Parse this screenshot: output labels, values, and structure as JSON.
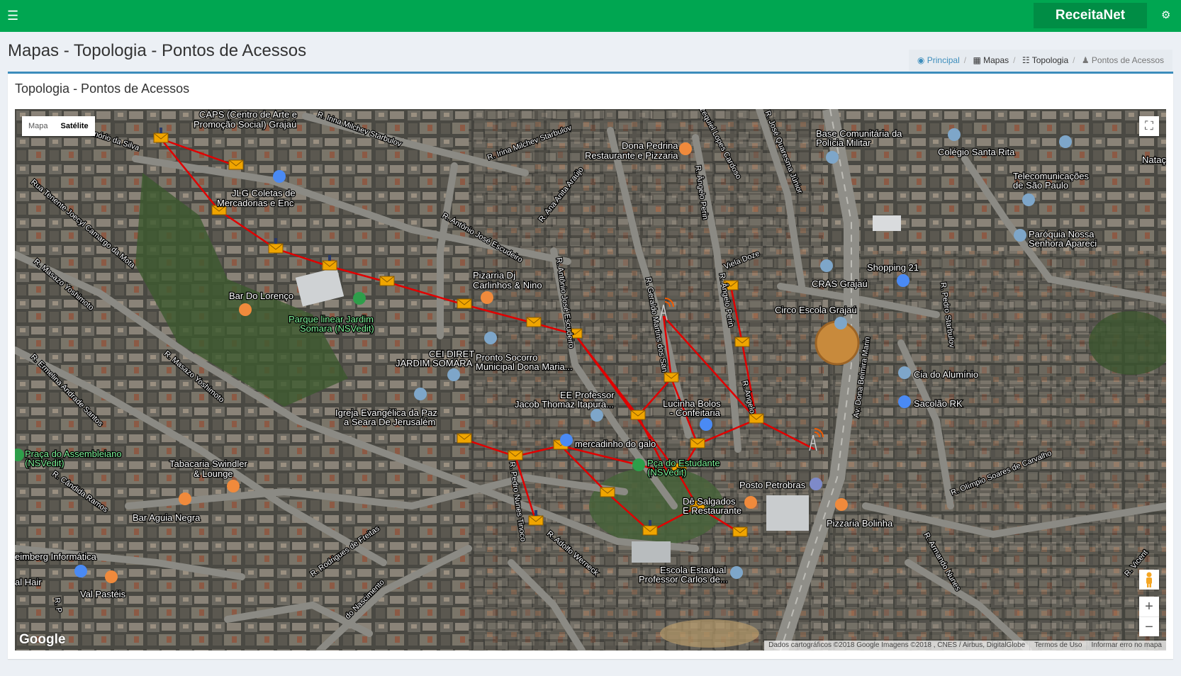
{
  "header": {
    "brand": "ReceitaNet",
    "menu_icon": "hamburger-icon",
    "settings_icon": "gears-icon",
    "brand_color": "#00a651"
  },
  "page": {
    "title": "Mapas - Topologia - Pontos de Acessos"
  },
  "breadcrumb": [
    {
      "label": "Principal",
      "icon": "dashboard-icon"
    },
    {
      "label": "Mapas",
      "icon": "map-icon"
    },
    {
      "label": "Topologia",
      "icon": "sitemap-icon"
    },
    {
      "label": "Pontos de Acessos",
      "icon": "user-icon"
    }
  ],
  "box": {
    "title": "Topologia - Pontos de Acessos"
  },
  "map": {
    "type_options": [
      "Mapa",
      "Satélite"
    ],
    "selected_type": "Satélite",
    "attribution": [
      "Dados cartográficos ©2018 Google Imagens ©2018 , CNES / Airbus, DigitalGlobe",
      "Termos de Uso",
      "Informar erro no mapa"
    ],
    "logo": "Google",
    "link_color": "#e00000",
    "marker_color": "#f0a500",
    "places": [
      "CAPS (Centro de Arte e",
      "Promoção Social) Grajaú",
      "JLG Coletas de",
      "Mercadorias e Enc",
      "Dona Pedrina",
      "Restaurante e Pizzaria",
      "Base Comunitária da",
      "Polícia Militar",
      "Colégio Santa Rita",
      "Natação Flo",
      "Telecomunicações",
      "de São Paulo",
      "Paróquia Nossa",
      "Senhora Apareci",
      "Shopping 21",
      "CRAS Grajaú",
      "Circo Escola Grajaú",
      "Pizarria Dj",
      "Carlinhos & Nino",
      "Bar Do Lorenço",
      "Parque linear Jardim",
      "Somara (NSVedit)",
      "CEI DIRET",
      "JARDIM SOMARA",
      "Pronto Socorro",
      "Municipal Dona Maria...",
      "EE Professor",
      "Jacob Thomaz Itapura...",
      "Lucinha Bolos",
      "- Confeitaria",
      "Cia do Alumínio",
      "Sacolão RK",
      "Igreja Evangélica da Paz",
      "a Seara De Jerusalém",
      "mercadinho do galo",
      "Pça do Estudante",
      "(NSVedit)",
      "Praça do Assembleiano",
      "(NSVedit)",
      "Tabacaria Swindler",
      "& Lounge",
      "Posto Petrobras",
      "Dê Salgados",
      "E Restaurante",
      "Pizzaria Bolinha",
      "Bar Aguia Negra",
      "eimberg Informática",
      "al Hair",
      "Val Pastéis",
      "Escola Estadual",
      "Professor Carlos de..."
    ],
    "streets": [
      "R. Irina Milchev Starbulov",
      "R. Irina Milchev Starbulov",
      "onório da Silva",
      "Rua Tenente Joecyl Camargo da Mota",
      "R. Masazo Yoshimoto",
      "R. Masazo Yoshimoto",
      "R. Ana Anita Araújo",
      "R. Antônio José Escudeiro",
      "R. Antônio José Escudeiro",
      "zequiel Lopes Cardoso",
      "R. José Quaresma Júnior",
      "R. Ângelo Perin",
      "R. Ângelo Perin",
      "Viela Doze",
      "R. Geraldo Martins dos San",
      "R. Angelo",
      "Av. Dona Belmira Marin",
      "R. Pedro Starbulov",
      "R. Olímpio Soares de Carvalho",
      "R. Ermelina Andrade Santos",
      "R. Cândida Ramos",
      "R. Rodrigues de Freitas",
      "R. Pedro Nunes Tinoco",
      "R. Adolfo Werneck",
      "R. Armando Nunes",
      "R. Vicent",
      "do Nascimento",
      "R. P"
    ]
  }
}
